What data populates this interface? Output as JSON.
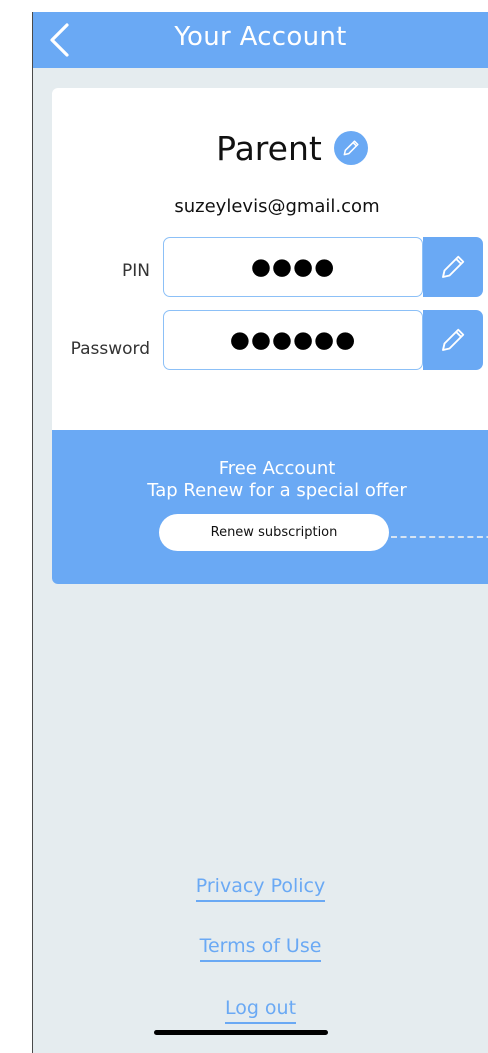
{
  "header": {
    "title": "Your Account",
    "back_icon": "chevron-left-icon"
  },
  "profile": {
    "name": "Parent",
    "edit_icon": "pencil-icon",
    "email": "suzeylevis@gmail.com"
  },
  "fields": [
    {
      "label": "PIN",
      "value": "●●●●",
      "edit_icon": "pencil-icon"
    },
    {
      "label": "Password",
      "value": "●●●●●●",
      "edit_icon": "pencil-icon"
    }
  ],
  "promo": {
    "line1": "Free Account",
    "line2": "Tap Renew for a special offer",
    "button_label": "Renew subscription"
  },
  "footer": {
    "privacy": "Privacy Policy",
    "terms": "Terms of Use",
    "logout": "Log out"
  },
  "colors": {
    "accent": "#6aa9f4",
    "background": "#e5ecef",
    "card": "#ffffff"
  }
}
